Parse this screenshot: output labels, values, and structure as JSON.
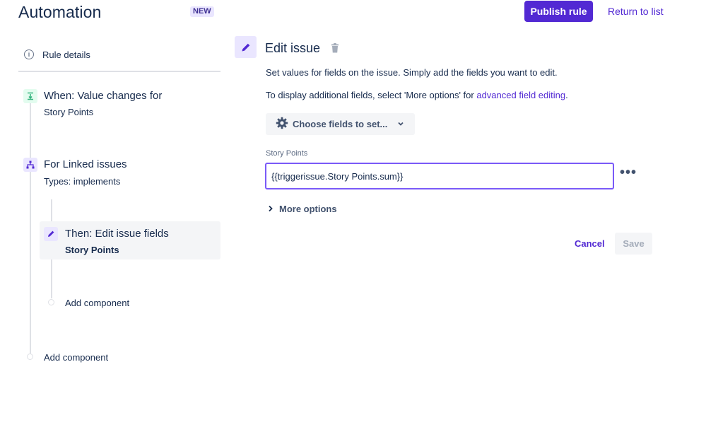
{
  "header": {
    "title": "Automation",
    "badge": "NEW",
    "publish_label": "Publish rule",
    "return_label": "Return to list"
  },
  "sidebar": {
    "rule_details_label": "Rule details",
    "trigger": {
      "title": "When: Value changes for",
      "subtitle": "Story Points",
      "icon": "trigger-icon"
    },
    "branch": {
      "title": "For Linked issues",
      "subtitle": "Types: implements",
      "icon": "branch-icon"
    },
    "action": {
      "title": "Then: Edit issue fields",
      "subtitle": "Story Points",
      "icon": "pencil-icon"
    },
    "add_component_nested": "Add component",
    "add_component_root": "Add component"
  },
  "panel": {
    "title": "Edit issue",
    "desc1": "Set values for fields on the issue. Simply add the fields you want to edit.",
    "desc2_prefix": "To display additional fields, select 'More options' for ",
    "desc2_link": "advanced field editing",
    "desc2_suffix": ".",
    "choose_fields_label": "Choose fields to set...",
    "field_label": "Story Points",
    "field_value": "{{triggerissue.Story Points.sum}}",
    "field_menu": "•••",
    "more_options_label": "More options",
    "cancel_label": "Cancel",
    "save_label": "Save"
  },
  "colors": {
    "accent": "#5229d3",
    "input_focus": "#7a5af8",
    "trigger_bg": "#e3fcef",
    "component_bg": "#eae6ff"
  }
}
